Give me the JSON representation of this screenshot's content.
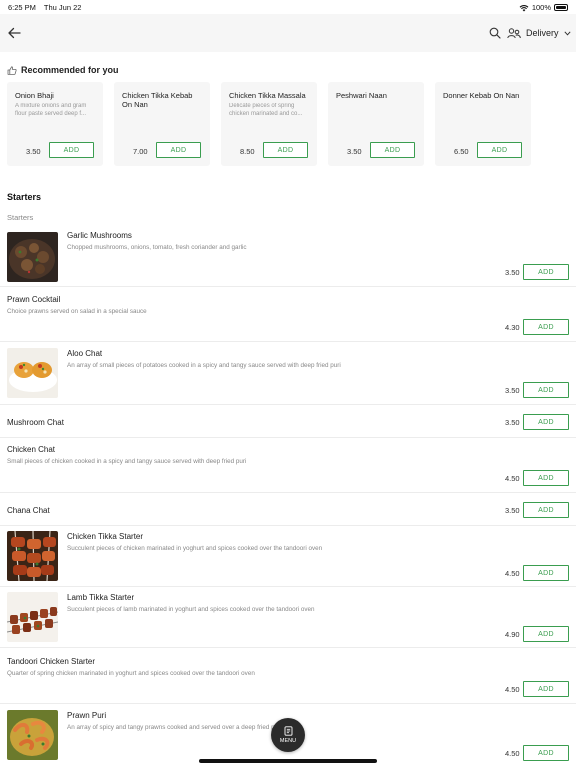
{
  "status_bar": {
    "time": "6:25 PM",
    "date": "Thu Jun 22",
    "battery": "100%"
  },
  "header": {
    "delivery_label": "Delivery"
  },
  "recommended": {
    "title": "Recommended for you",
    "items": [
      {
        "name": "Onion Bhaji",
        "desc": "A mixture onions and gram flour paste served deep f...",
        "price": "3.50",
        "add": "ADD"
      },
      {
        "name": "Chicken Tikka Kebab On Nan",
        "desc": "",
        "price": "7.00",
        "add": "ADD"
      },
      {
        "name": "Chicken Tikka Massala",
        "desc": "Delicate pieces of spring chicken marinated and co...",
        "price": "8.50",
        "add": "ADD"
      },
      {
        "name": "Peshwari Naan",
        "desc": "",
        "price": "3.50",
        "add": "ADD"
      },
      {
        "name": "Donner Kebab On Nan",
        "desc": "",
        "price": "6.50",
        "add": "ADD"
      }
    ]
  },
  "section": {
    "title": "Starters",
    "subtitle": "Starters"
  },
  "menu_items": [
    {
      "name": "Garlic Mushrooms",
      "desc": "Chopped mushrooms, onions, tomato, fresh coriander and garlic",
      "price": "3.50",
      "add": "ADD"
    },
    {
      "name": "Prawn Cocktail",
      "desc": "Choice prawns served on salad in a special sauce",
      "price": "4.30",
      "add": "ADD"
    },
    {
      "name": "Aloo Chat",
      "desc": "An array of small pieces of potatoes cooked in a spicy and tangy sauce served with deep fried puri",
      "price": "3.50",
      "add": "ADD"
    },
    {
      "name": "Mushroom Chat",
      "desc": "",
      "price": "3.50",
      "add": "ADD"
    },
    {
      "name": "Chicken Chat",
      "desc": "Small pieces of chicken cooked in a spicy and tangy sauce served with deep fried puri",
      "price": "4.50",
      "add": "ADD"
    },
    {
      "name": "Chana Chat",
      "desc": "",
      "price": "3.50",
      "add": "ADD"
    },
    {
      "name": "Chicken Tikka Starter",
      "desc": "Succulent pieces of chicken marinated in yoghurt and spices cooked over the tandoori oven",
      "price": "4.50",
      "add": "ADD"
    },
    {
      "name": "Lamb Tikka Starter",
      "desc": "Succulent pieces of lamb marinated in yoghurt and spices cooked over the tandoori oven",
      "price": "4.90",
      "add": "ADD"
    },
    {
      "name": "Tandoori Chicken Starter",
      "desc": "Quarter of spring chicken marinated in yoghurt and spices cooked over the tandoori oven",
      "price": "4.50",
      "add": "ADD"
    },
    {
      "name": "Prawn Puri",
      "desc": "An array of spicy and tangy prawns cooked and served over a deep fried puri",
      "price": "4.50",
      "add": "ADD"
    }
  ],
  "fab": {
    "label": "MENU"
  },
  "colors": {
    "accent": "#3a9d4f",
    "header_bg": "#f6f6f6",
    "card_bg": "#f6f6f6",
    "fab_bg": "#2b2b2b"
  }
}
